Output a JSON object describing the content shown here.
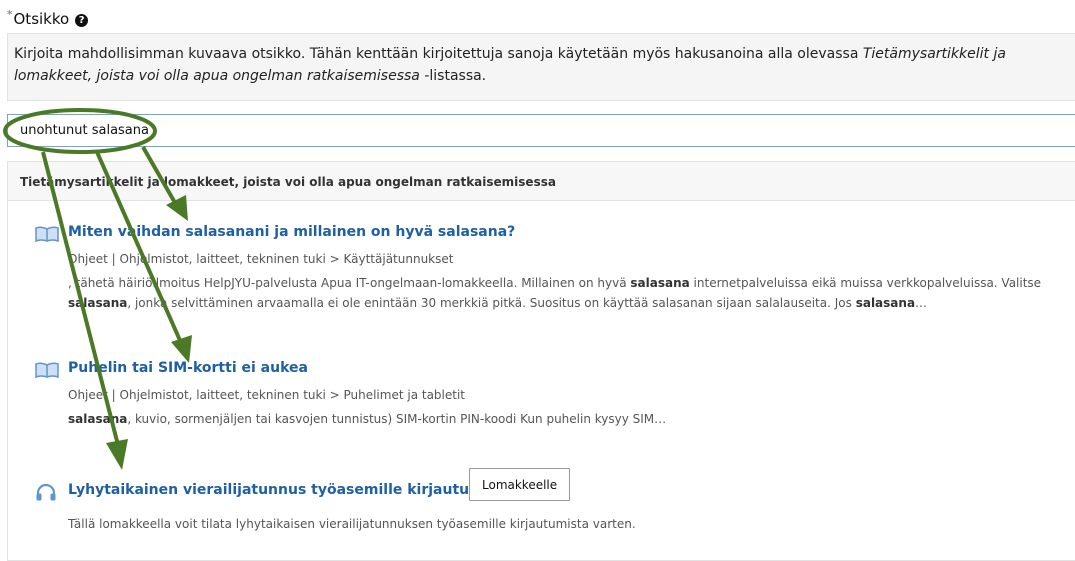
{
  "field": {
    "required_mark": "*",
    "label": "Otsikko",
    "help_icon": "question-circle-icon",
    "hint_part1": "Kirjoita mahdollisimman kuvaava otsikko. Tähän kenttään kirjoitettuja sanoja käytetään myös hakusanoina alla olevassa ",
    "hint_em": "Tietämysartikkelit ja lomakkeet, joista voi olla apua ongelman ratkaisemisessa",
    "hint_part2": " -listassa.",
    "value": "unohtunut salasana"
  },
  "kb": {
    "header": "Tietämysartikkelit ja lomakkeet, joista voi olla apua ongelman ratkaisemisessa",
    "items": [
      {
        "icon": "book-icon",
        "title": "Miten vaihdan salasanani ja millainen on hyvä salasana?",
        "path": "Ohjeet | Ohjelmistot, laitteet, tekninen tuki > Käyttäjätunnukset",
        "snippet_a1": ", tähetä häiriöilmoitus HelpJYU-palvelusta Apua IT-ongelmaan-lomakkeella. Millainen on hyvä ",
        "snippet_b1": "salasana",
        "snippet_a2": " internetpalveluissa eikä muissa verkkopalveluissa. Valitse ",
        "snippet_b2": "salasana",
        "snippet_a3": ", jonka selvittäminen arvaamalla ei ole enintään 30 merkkiä pitkä. Suositus on käyttää salasanan sijaan salalauseita. Jos ",
        "snippet_b3": "salasana",
        "snippet_a4": "…"
      },
      {
        "icon": "book-icon",
        "title": "Puhelin tai SIM-kortti ei aukea",
        "path": "Ohjeet | Ohjelmistot, laitteet, tekninen tuki > Puhelimet ja tabletit",
        "snippet_b1": "salasana",
        "snippet_a1": ", kuvio, sormenjäljen tai kasvojen tunnistus)   SIM-kortin PIN-koodi  Kun puhelin kysyy SIM…"
      },
      {
        "icon": "headset-icon",
        "title": "Lyhytaikainen vierailijatunnus työasemille kirjautumiseen",
        "button": "Lomakkeelle",
        "snippet": "Tällä lomakkeella voit tilata lyhytaikaisen vierailijatunnuksen työasemille kirjautumista varten."
      }
    ]
  },
  "annotation": {
    "color": "#4a7a25"
  }
}
